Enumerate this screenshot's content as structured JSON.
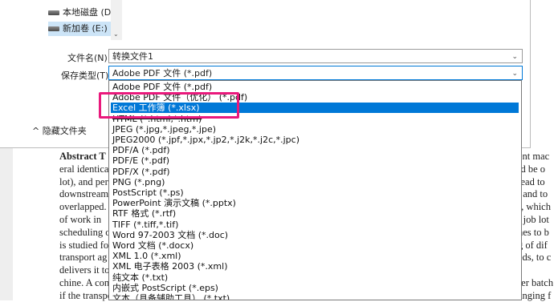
{
  "dialog": {
    "drives": [
      {
        "label": "本地磁盘 (D:)"
      },
      {
        "label": "新加卷 (E:)"
      }
    ],
    "filename_label": "文件名(N):",
    "filename_value": "转换文件1",
    "filetype_label": "保存类型(T):",
    "filetype_value": "Adobe PDF 文件 (*.pdf)",
    "hide_folders_label": "隐藏文件夹"
  },
  "filetype_options": [
    "Adobe PDF 文件 (*.pdf)",
    "Adobe PDF 文件（优化） (*.pdf)",
    "Excel 工作簿 (*.xlsx)",
    "HTML (*.html,*.htm)",
    "JPEG (*.jpg,*.jpeg,*.jpe)",
    "JPEG2000 (*.jpf,*.jpx,*.jp2,*.j2k,*.j2c,*.jpc)",
    "PDF/A (*.pdf)",
    "PDF/E (*.pdf)",
    "PDF/X (*.pdf)",
    "PNG (*.png)",
    "PostScript (*.ps)",
    "PowerPoint 演示文稿 (*.pptx)",
    "RTF 格式 (*.rtf)",
    "TIFF (*.tiff,*.tif)",
    "Word 97-2003 文档 (*.doc)",
    "Word 文档 (*.docx)",
    "XML 1.0 (*.xml)",
    "XML 电子表格 2003 (*.xml)",
    "纯文本 (*.txt)",
    "内嵌式 PostScript (*.eps)",
    "文本（具备辅助工具） (*.txt)"
  ],
  "selected_option": "Excel 工作簿 (*.xlsx)",
  "document": {
    "left_lines": [
      "Abstract  T",
      "eral identica",
      "lot), and per",
      "downstream",
      "overlapped.",
      "of work in",
      "scheduling o",
      "is studied fo",
      "transport ag",
      "delivers it to",
      "chine. A con",
      "if the transpo"
    ],
    "right_lines": [
      "ent mac",
      "ld be o",
      "lead to",
      ", and to",
      "), which",
      "l job lot",
      "hes to b",
      "g of dif",
      "eds, to c",
      "",
      "fer batch",
      "anging f"
    ]
  }
}
